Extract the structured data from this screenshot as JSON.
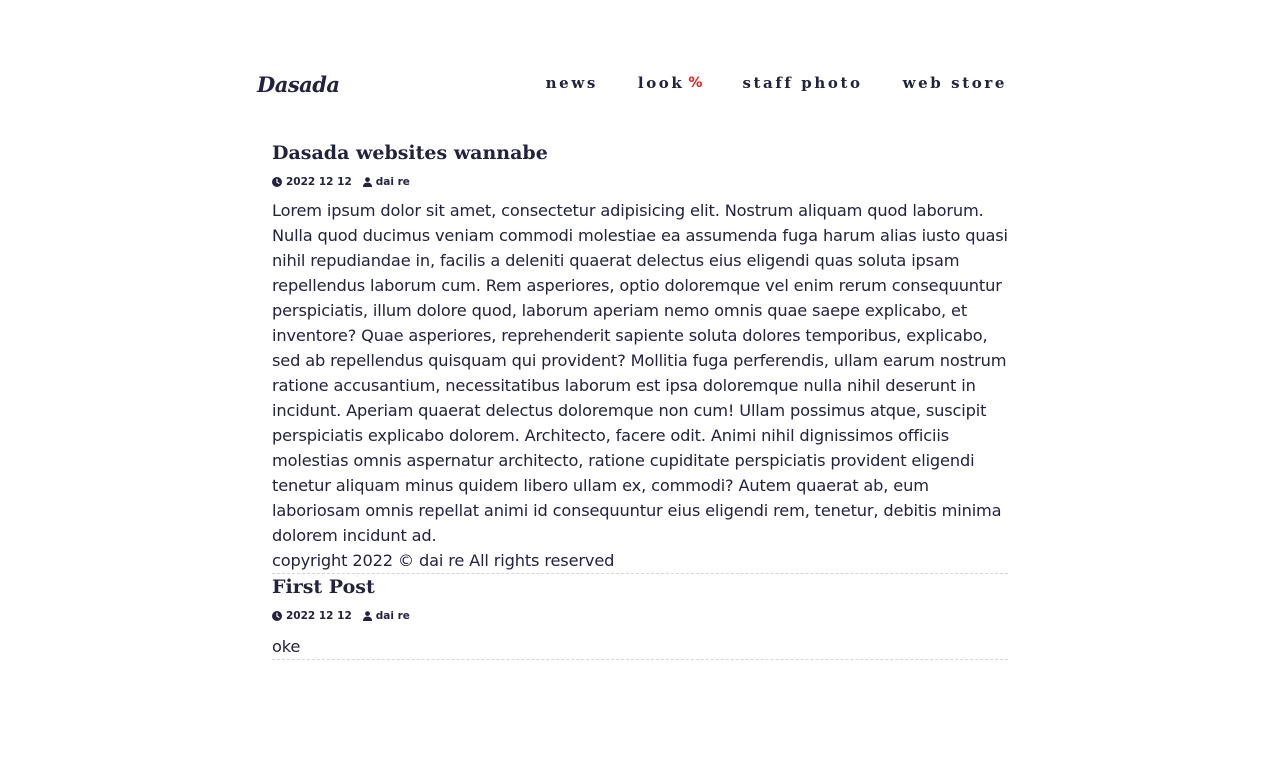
{
  "header": {
    "logo": "Dasada",
    "nav": [
      {
        "label": "news"
      },
      {
        "label": "look",
        "badge": "%"
      },
      {
        "label": "staff photo"
      },
      {
        "label": "web store"
      }
    ]
  },
  "posts": [
    {
      "title": "Dasada websites wannabe",
      "date": "2022 12 12",
      "author": "dai re",
      "body": "Lorem ipsum dolor sit amet, consectetur adipisicing elit. Nostrum aliquam quod laborum. Nulla quod ducimus veniam commodi molestiae ea assumenda fuga harum alias iusto quasi nihil repudiandae in, facilis a deleniti quaerat delectus eius eligendi quas soluta ipsam repellendus laborum cum. Rem asperiores, optio doloremque vel enim rerum consequuntur perspiciatis, illum dolore quod, laborum aperiam nemo omnis quae saepe explicabo, et inventore? Quae asperiores, reprehenderit sapiente soluta dolores temporibus, explicabo, sed ab repellendus quisquam qui provident? Mollitia fuga perferendis, ullam earum nostrum ratione accusantium, necessitatibus laborum est ipsa doloremque nulla nihil deserunt in incidunt. Aperiam quaerat delectus doloremque non cum! Ullam possimus atque, suscipit perspiciatis explicabo dolorem. Architecto, facere odit. Animi nihil dignissimos officiis molestias omnis aspernatur architecto, ratione cupiditate perspiciatis provident eligendi tenetur aliquam minus quidem libero ullam ex, commodi? Autem quaerat ab, eum laboriosam omnis repellat animi id consequuntur eius eligendi rem, tenetur, debitis minima dolorem incidunt ad.",
      "footer": "copyright 2022 © dai re All rights reserved"
    },
    {
      "title": "First Post",
      "date": "2022 12 12",
      "author": "dai re",
      "body": "oke"
    }
  ],
  "colors": {
    "text": "#23223f",
    "accent": "#e0201b",
    "divider": "#d4d4dc"
  },
  "icons": {
    "date": "clock-icon",
    "author": "user-icon"
  }
}
